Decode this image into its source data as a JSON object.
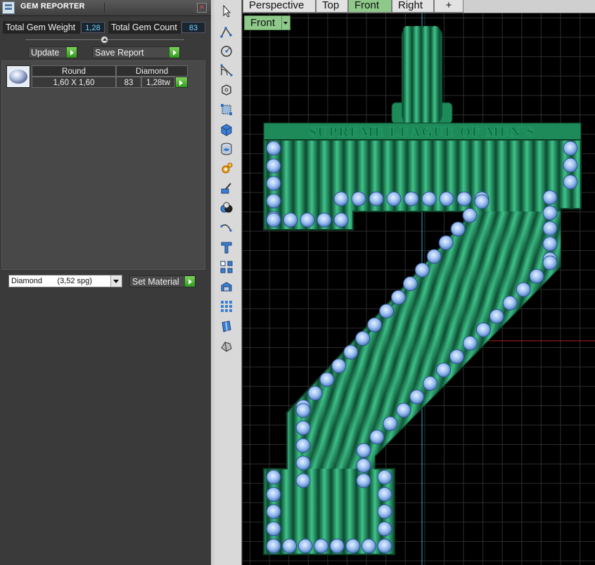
{
  "panel": {
    "title": "GEM REPORTER",
    "total_weight_label": "Total Gem Weight",
    "total_weight_value": "1,28",
    "total_count_label": "Total Gem Count",
    "total_count_value": "83",
    "update_label": "Update",
    "save_report_label": "Save Report",
    "table": {
      "shape_header": "Round",
      "material_header": "Diamond",
      "size": "1,60 X 1,60",
      "count": "83",
      "weight": "1,28tw"
    },
    "material_select": "Diamond       (3,52 spg)",
    "set_material_label": "Set Material"
  },
  "toolbar": {
    "tools": [
      "select-arrow-icon",
      "polyline-icon",
      "circle-icon",
      "arc-icon",
      "polygon-icon",
      "transform-icon",
      "box-icon",
      "cylinder-icon",
      "gear-icon",
      "paint-icon",
      "boolean-icon",
      "curve-icon",
      "text-tool-icon",
      "array-icon",
      "extrude-icon",
      "grid-icon",
      "gem-tool-icon",
      "solid-icon"
    ]
  },
  "viewport": {
    "tabs": [
      "Perspective",
      "Top",
      "Front",
      "Right",
      "+"
    ],
    "active_tab": "Front",
    "view_label": "Front",
    "engraving": "SUPREME LEAGUE OF MEN'S",
    "colors": {
      "metal": "#1e8a5a",
      "gem": "#a9c8f2",
      "grid": "#2e2e2e",
      "axis_x": "#b02020",
      "axis_y": "#2aa6c8"
    }
  }
}
